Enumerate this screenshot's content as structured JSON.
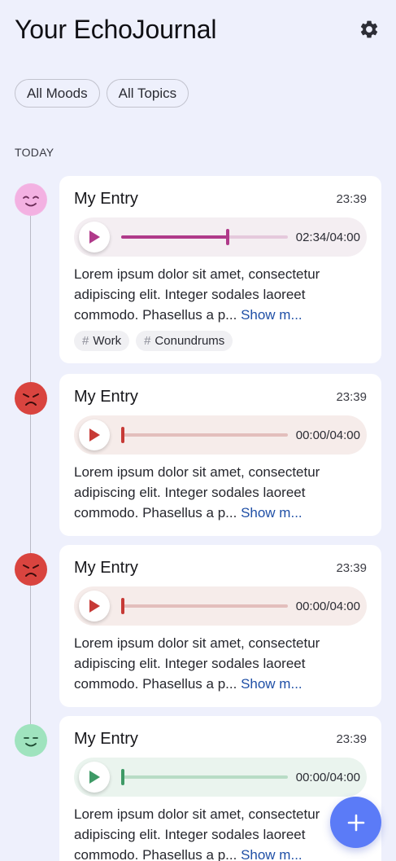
{
  "header": {
    "title": "Your EchoJournal",
    "settings_icon": "gear-icon"
  },
  "filters": [
    {
      "label": "All Moods"
    },
    {
      "label": "All Topics"
    }
  ],
  "section": {
    "label": "TODAY"
  },
  "colors": {
    "background": "#EEF0FC",
    "fab": "#5B7BF7",
    "link": "#1F4FA6"
  },
  "entries": [
    {
      "mood": "peaceful",
      "mood_icon": "peaceful-face-icon",
      "title": "My Entry",
      "time": "23:39",
      "audio": {
        "duration_text": "02:34/04:00",
        "progress": 0.64,
        "accent": "#B03A8A",
        "track": "#E5C9DC",
        "bg": "#F4EEF2"
      },
      "text": "Lorem ipsum dolor sit amet, consectetur adipiscing elit. Integer sodales laoreet commodo. Phasellus a p...",
      "show_more": "Show m...",
      "tags": [
        "Work",
        "Conundrums"
      ]
    },
    {
      "mood": "stressed",
      "mood_icon": "angry-face-icon",
      "title": "My Entry",
      "time": "23:39",
      "audio": {
        "duration_text": "00:00/04:00",
        "progress": 0,
        "accent": "#C73A36",
        "track": "#E3BEBC",
        "bg": "#F6ECEA"
      },
      "text": "Lorem ipsum dolor sit amet, consectetur adipiscing elit. Integer sodales laoreet commodo. Phasellus a p...",
      "show_more": "Show m...",
      "tags": []
    },
    {
      "mood": "stressed",
      "mood_icon": "angry-face-icon",
      "title": "My Entry",
      "time": "23:39",
      "audio": {
        "duration_text": "00:00/04:00",
        "progress": 0,
        "accent": "#C73A36",
        "track": "#E3BEBC",
        "bg": "#F6ECEA"
      },
      "text": "Lorem ipsum dolor sit amet, consectetur adipiscing elit. Integer sodales laoreet commodo. Phasellus a p...",
      "show_more": "Show m...",
      "tags": []
    },
    {
      "mood": "neutral",
      "mood_icon": "smiling-face-icon",
      "title": "My Entry",
      "time": "23:39",
      "audio": {
        "duration_text": "00:00/04:00",
        "progress": 0,
        "accent": "#3E9A66",
        "track": "#B8DCC5",
        "bg": "#EAF4EE"
      },
      "text": "Lorem ipsum dolor sit amet, consectetur adipiscing elit. Integer sodales laoreet commodo. Phasellus a p...",
      "show_more": "Show m...",
      "tags": []
    }
  ],
  "fab": {
    "icon": "plus-icon"
  }
}
